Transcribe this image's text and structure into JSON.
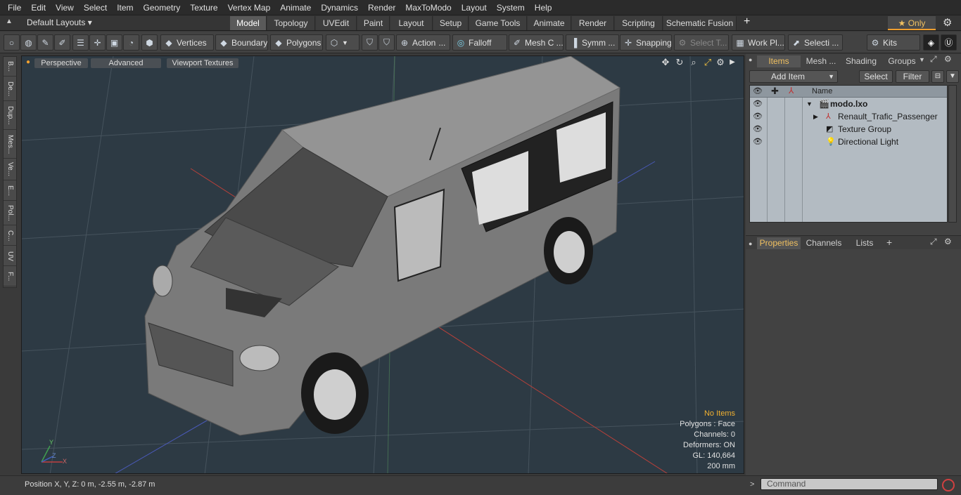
{
  "menu": [
    "File",
    "Edit",
    "View",
    "Select",
    "Item",
    "Geometry",
    "Texture",
    "Vertex Map",
    "Animate",
    "Dynamics",
    "Render",
    "MaxToModo",
    "Layout",
    "System",
    "Help"
  ],
  "tabs": {
    "layout_dropdown": "Default Layouts ▾",
    "items": [
      "Model",
      "Topology",
      "UVEdit",
      "Paint",
      "Layout",
      "Setup",
      "Game Tools",
      "Animate",
      "Render",
      "Scripting",
      "Schematic Fusion"
    ],
    "active": "Model",
    "add": "+",
    "only": "★  Only",
    "gear": "⚙"
  },
  "toolbar": {
    "vertices": "Vertices",
    "boundary": "Boundary",
    "polygons": "Polygons",
    "action": "Action",
    "action_more": "...",
    "falloff": "Falloff",
    "mesh": "Mesh C ...",
    "symm": "Symm ...",
    "snapping": "Snapping",
    "select_t": "Select T...",
    "work_pl": "Work Pl...",
    "selecti": "Selecti ...",
    "kits": "Kits"
  },
  "left_tabs": [
    "B...",
    "De...",
    "Dup...",
    "Mes...",
    "Ve...",
    "E...",
    "Pol...",
    "C...",
    "UV",
    "F..."
  ],
  "viewport": {
    "tabs": [
      "Perspective",
      "Advanced",
      "Viewport Textures"
    ],
    "stats": {
      "no_items": "No Items",
      "polygons": "Polygons : Face",
      "channels": "Channels: 0",
      "deformers": "Deformers: ON",
      "gl": "GL: 140,664",
      "unit": "200 mm"
    },
    "axis": {
      "x": "X",
      "y": "Y",
      "z": "Z"
    }
  },
  "status": {
    "position": "Position X, Y, Z:   0 m, -2.55 m, -2.87 m"
  },
  "items_panel": {
    "tabs": [
      "Items",
      "Mesh ...",
      "Shading",
      "Groups"
    ],
    "add_item": "Add Item",
    "select": "Select",
    "filter": "Filter",
    "header_name": "Name",
    "rows": [
      {
        "label": "modo.lxo"
      },
      {
        "label": "Renault_Trafic_Passenger"
      },
      {
        "label": "Texture Group"
      },
      {
        "label": "Directional Light"
      }
    ]
  },
  "properties_panel": {
    "tabs": [
      "Properties",
      "Channels",
      "Lists"
    ],
    "add": "+"
  },
  "command": {
    "placeholder": "Command",
    "prompt": ">"
  },
  "colors": {
    "accent": "#f0a030",
    "viewport_bg": "#2d3a44",
    "panel": "#424242"
  }
}
